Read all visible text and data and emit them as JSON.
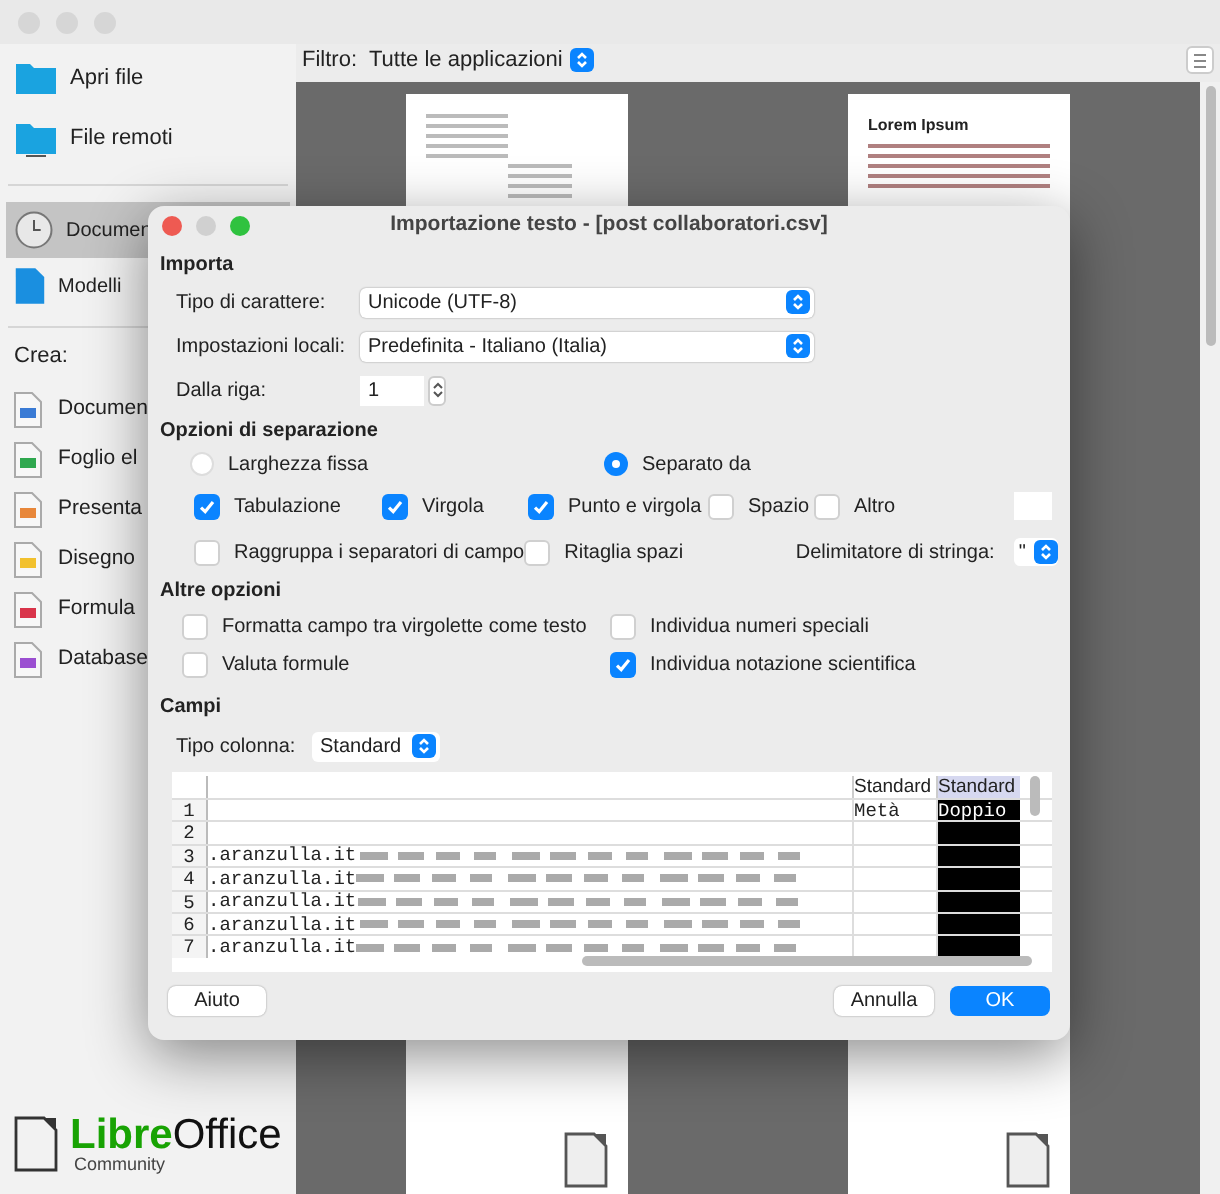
{
  "window": {
    "filter_label": "Filtro:",
    "filter_value": "Tutte le applicazioni"
  },
  "sidebar": {
    "items": [
      {
        "label": "Apri file",
        "kind": "folder",
        "selected": false
      },
      {
        "label": "File remoti",
        "kind": "remote",
        "selected": false
      },
      {
        "label": "Documen",
        "kind": "recent",
        "selected": true
      },
      {
        "label": "Modelli",
        "kind": "templates",
        "selected": false
      }
    ],
    "create_label": "Crea:",
    "create_items": [
      {
        "label": "Documen",
        "color": "#3a7bd5"
      },
      {
        "label": "Foglio el",
        "color": "#2fa84f"
      },
      {
        "label": "Presenta",
        "color": "#e8873a"
      },
      {
        "label": "Disegno",
        "color": "#f2c12e"
      },
      {
        "label": "Formula",
        "color": "#d9344a"
      },
      {
        "label": "Database",
        "color": "#9b4fd1"
      }
    ],
    "logo": {
      "part_1": "Libre",
      "part_2": "Office",
      "tagline": "Community"
    }
  },
  "thumbnails": [
    {
      "kind": "letter"
    },
    {
      "kind": "article",
      "title": "Lorem Ipsum"
    }
  ],
  "dialog": {
    "title": "Importazione testo - [post collaboratori.csv]",
    "import": {
      "heading": "Importa",
      "charset_label": "Tipo di carattere:",
      "charset": "Unicode (UTF-8)",
      "locale_label": "Impostazioni locali:",
      "locale": "Predefinita - Italiano (Italia)",
      "from_row_label": "Dalla riga:",
      "from_row": "1"
    },
    "separation": {
      "heading": "Opzioni di separazione",
      "modes": [
        {
          "label": "Larghezza fissa",
          "selected": false
        },
        {
          "label": "Separato da",
          "selected": true
        }
      ],
      "separators": [
        {
          "label": "Tabulazione",
          "checked": true
        },
        {
          "label": "Virgola",
          "checked": true
        },
        {
          "label": "Punto e virgola",
          "checked": true
        },
        {
          "label": "Spazio",
          "checked": false
        },
        {
          "label": "Altro",
          "checked": false
        }
      ],
      "merge": {
        "label": "Raggruppa i separatori di campo",
        "checked": false
      },
      "trim": {
        "label": "Ritaglia spazi",
        "checked": false
      },
      "delimiter_label": "Delimitatore di stringa:",
      "delimiter": "\""
    },
    "other": {
      "heading": "Altre opzioni",
      "options": [
        {
          "label": "Formatta campo tra virgolette come testo",
          "checked": false
        },
        {
          "label": "Individua numeri speciali",
          "checked": false
        },
        {
          "label": "Valuta formule",
          "checked": false
        },
        {
          "label": "Individua notazione scientifica",
          "checked": true
        }
      ]
    },
    "fields": {
      "heading": "Campi",
      "column_type_label": "Tipo colonna:",
      "column_type": "Standard",
      "columns": [
        {
          "label": "Standard",
          "selected": false
        },
        {
          "label": "Standard",
          "selected": true
        }
      ],
      "rows": [
        {
          "number": "1",
          "cells": [
            "Metà",
            "Doppio"
          ]
        },
        {
          "number": "2",
          "cells": [
            null,
            null
          ]
        },
        {
          "number": "3",
          "text": ".aranzulla.it",
          "cells": [
            null,
            null
          ]
        },
        {
          "number": "4",
          "text": ".aranzulla.it",
          "cells": [
            null,
            null
          ]
        },
        {
          "number": "5",
          "text": ".aranzulla.it",
          "cells": [
            null,
            null
          ]
        },
        {
          "number": "6",
          "text": ".aranzulla.it",
          "cells": [
            null,
            null
          ]
        },
        {
          "number": "7",
          "text": ".aranzulla.it",
          "cells": [
            null,
            null
          ]
        }
      ]
    },
    "buttons": {
      "help": "Aiuto",
      "cancel": "Annulla",
      "ok": "OK"
    }
  }
}
